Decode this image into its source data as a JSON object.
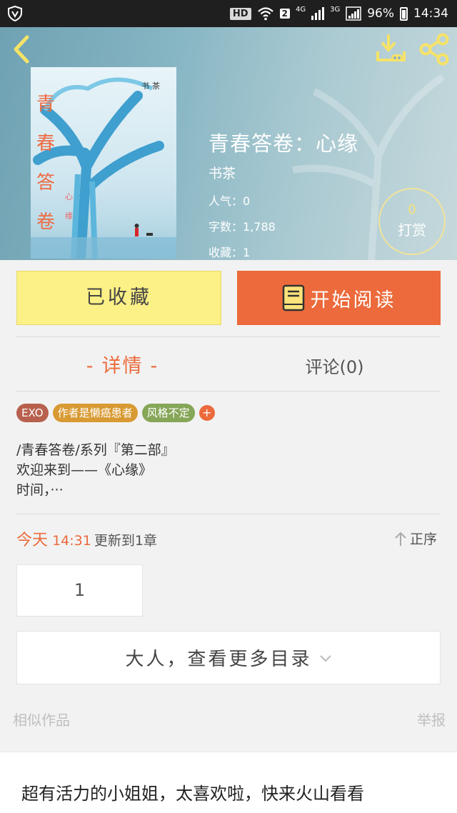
{
  "status_bar": {
    "hd_label": "HD",
    "sim_number": "2",
    "network_4g": "4G",
    "network_3g": "3G",
    "battery": "96%",
    "time": "14:34"
  },
  "book": {
    "title": "青春答卷：心缘",
    "author": "书茶",
    "popularity_label": "人气：",
    "popularity_value": "0",
    "word_count_label": "字数：",
    "word_count_value": "1,788",
    "favorites_label": "收藏：",
    "favorites_value": "1"
  },
  "tip": {
    "count": "0",
    "label": "打赏"
  },
  "actions": {
    "saved_label": "已收藏",
    "read_label": "开始阅读"
  },
  "tabs": {
    "details_dash_left": "-",
    "details_label": "详情",
    "details_dash_right": "-",
    "comments_label": "评论(0)"
  },
  "tags": [
    "EXO",
    "作者是懒癌患者",
    "风格不定",
    "+"
  ],
  "intro": {
    "line1": "/青春答卷/系列『第二部』",
    "line2": "欢迎来到——《心缘》",
    "line3": "时间，···"
  },
  "update": {
    "date": "今天",
    "time": "14:31",
    "text": "更新到1章"
  },
  "sort_label": "正序",
  "chapters": [
    "1"
  ],
  "more_catalog_label": "大人，查看更多目录",
  "footer": {
    "similar_label": "相似作品",
    "report_label": "举报"
  },
  "ad": {
    "text": "超有活力的小姐姐，太喜欢啦，快来火山看看"
  },
  "colors": {
    "accent": "#ec6a3b",
    "saved_button": "#fcf186",
    "tag_exo": "#b8604e",
    "tag_author": "#d89a32",
    "tag_style": "#86a658"
  },
  "icons": [
    "shield-v-icon",
    "wifi-icon",
    "signal-icon",
    "battery-icon",
    "back-chevron-icon",
    "download-icon",
    "share-icon",
    "book-icon",
    "sort-arrow-icon",
    "chevron-down-icon"
  ]
}
